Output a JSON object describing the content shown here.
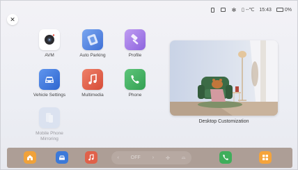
{
  "status_bar": {
    "temperature": "--℃",
    "time": "15:43",
    "battery": "0%"
  },
  "apps": [
    {
      "id": "avm",
      "label": "AVM",
      "icon": "camera-icon",
      "color": "#ffffff"
    },
    {
      "id": "auto-parking",
      "label": "Auto Parking",
      "icon": "auto-parking-icon",
      "color": "#5a8ee8"
    },
    {
      "id": "profile",
      "label": "Profile",
      "icon": "profile-hammer-icon",
      "color": "#a77ee8"
    },
    {
      "id": "vehicle-settings",
      "label": "Vehicle Settings",
      "icon": "car-icon",
      "color": "#3b79d9"
    },
    {
      "id": "multimedia",
      "label": "Multimedia",
      "icon": "music-note-icon",
      "color": "#e0614a"
    },
    {
      "id": "phone",
      "label": "Phone",
      "icon": "phone-icon",
      "color": "#3fae5b"
    },
    {
      "id": "mobile-phone-mirroring",
      "label": "Mobile Phone\nMirroring",
      "icon": "mirroring-icon",
      "color": "#c8d6ee",
      "disabled": true
    }
  ],
  "widget": {
    "label": "Desktop Customization"
  },
  "dock": {
    "fan_label": "OFF",
    "colors": {
      "home": "#f0a23a",
      "car": "#3b79d9",
      "music": "#e0614a",
      "phone": "#3fae5b",
      "apps": "#f5a43b"
    }
  }
}
